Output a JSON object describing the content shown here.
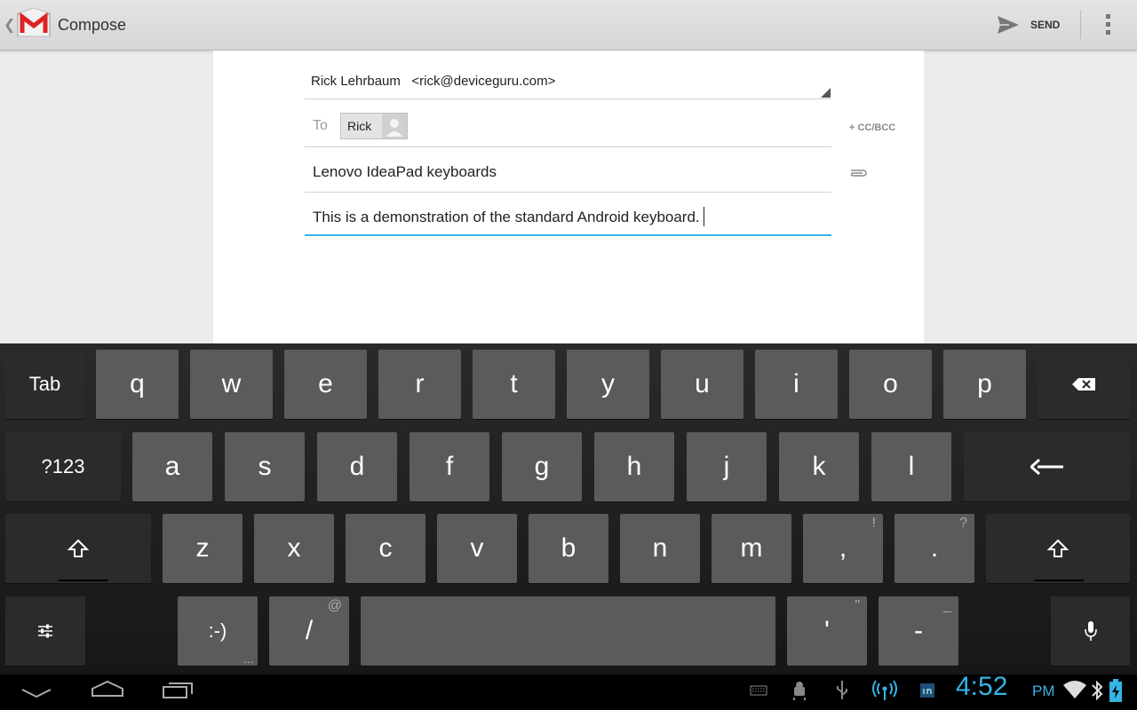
{
  "action_bar": {
    "title": "Compose",
    "send_label": "SEND"
  },
  "compose": {
    "from_name": "Rick Lehrbaum",
    "from_email": "<rick@deviceguru.com>",
    "to_label": "To",
    "to_recipients": [
      {
        "name": "Rick"
      }
    ],
    "cc_bcc_label": "+ CC/BCC",
    "subject": "Lenovo IdeaPad keyboards",
    "body": "This is a demonstration of the standard Android keyboard."
  },
  "keyboard": {
    "rows": [
      [
        {
          "label": "Tab",
          "name": "tab-key",
          "fn": true
        },
        {
          "label": "q"
        },
        {
          "label": "w"
        },
        {
          "label": "e"
        },
        {
          "label": "r"
        },
        {
          "label": "t"
        },
        {
          "label": "y"
        },
        {
          "label": "u"
        },
        {
          "label": "i"
        },
        {
          "label": "o"
        },
        {
          "label": "p"
        },
        {
          "icon": "backspace-icon",
          "name": "backspace-key",
          "fn": true
        }
      ],
      [
        {
          "label": "?123",
          "name": "symbols-key",
          "fn": true
        },
        {
          "label": "a"
        },
        {
          "label": "s"
        },
        {
          "label": "d"
        },
        {
          "label": "f"
        },
        {
          "label": "g"
        },
        {
          "label": "h"
        },
        {
          "label": "j"
        },
        {
          "label": "k"
        },
        {
          "label": "l"
        },
        {
          "icon": "enter-icon",
          "name": "enter-key",
          "fn": true
        }
      ],
      [
        {
          "icon": "shift-icon",
          "name": "shift-key-left",
          "fn": true
        },
        {
          "label": "z"
        },
        {
          "label": "x"
        },
        {
          "label": "c"
        },
        {
          "label": "v"
        },
        {
          "label": "b"
        },
        {
          "label": "n"
        },
        {
          "label": "m"
        },
        {
          "label": ",",
          "hint": "!",
          "name": "comma-key"
        },
        {
          "label": ".",
          "hint": "?",
          "name": "period-key"
        },
        {
          "icon": "shift-icon",
          "name": "shift-key-right",
          "fn": true
        }
      ],
      [
        {
          "icon": "settings-sliders-icon",
          "name": "settings-key",
          "fn": true
        },
        {
          "label": ":-)",
          "name": "smiley-key"
        },
        {
          "label": "/",
          "hint": "@",
          "name": "slash-key"
        },
        {
          "label": "",
          "name": "space-key"
        },
        {
          "label": "'",
          "hint": "\"",
          "name": "apostrophe-key"
        },
        {
          "label": "-",
          "hint": "_",
          "name": "hyphen-key"
        },
        {
          "icon": "microphone-icon",
          "name": "voice-key",
          "fn": true
        }
      ]
    ]
  },
  "system_bar": {
    "time": "4:52",
    "ampm": "PM",
    "nav_icons": [
      "back-icon",
      "home-icon",
      "recent-apps-icon"
    ],
    "status_icons": [
      "keyboard-icon",
      "android-debug-icon",
      "usb-icon",
      "hotspot-icon",
      "linkedin-icon",
      "wifi-icon",
      "bluetooth-icon",
      "battery-charging-icon"
    ]
  }
}
